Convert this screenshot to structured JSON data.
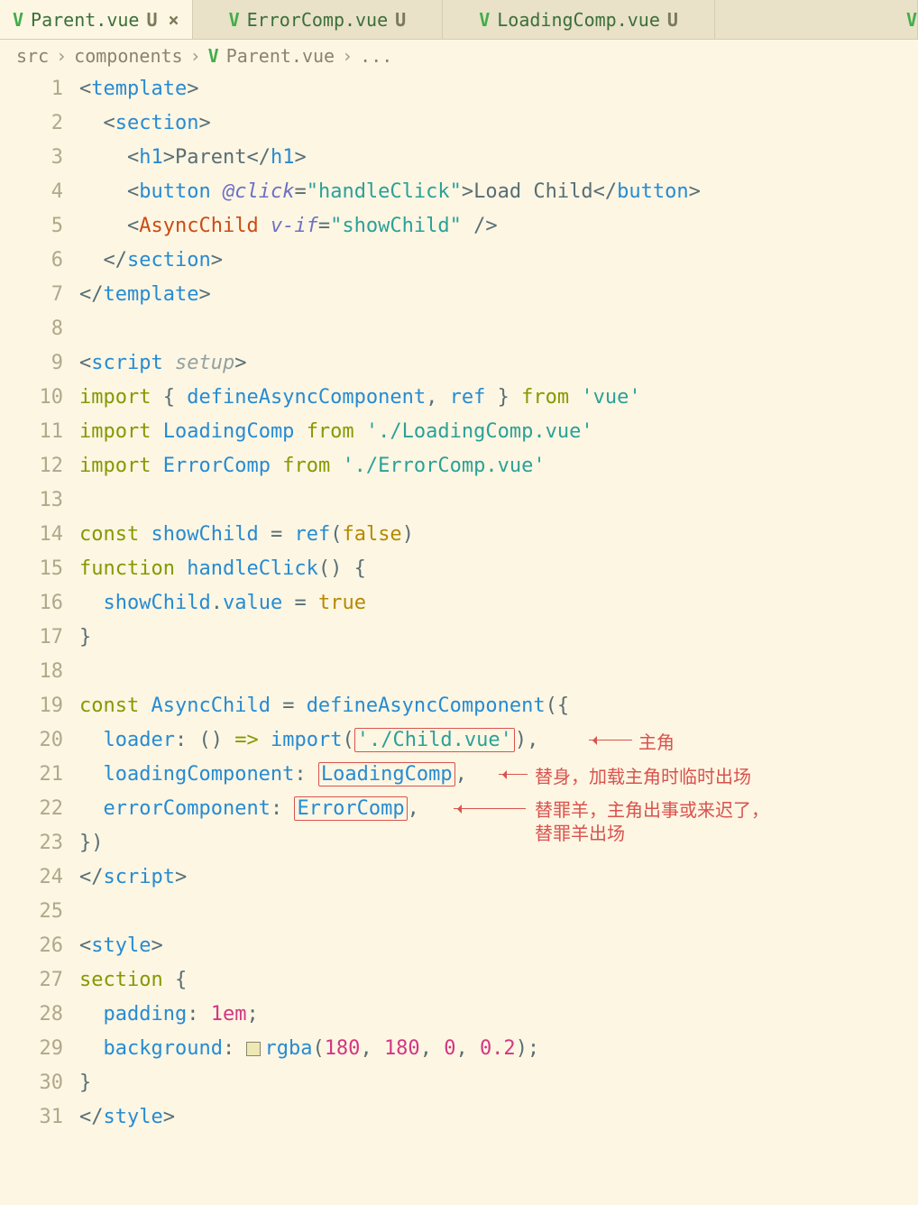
{
  "tabs": [
    {
      "icon": "V",
      "label": "Parent.vue",
      "mod": "U",
      "active": true,
      "close": true
    },
    {
      "icon": "V",
      "label": "ErrorComp.vue",
      "mod": "U",
      "active": false,
      "close": false
    },
    {
      "icon": "V",
      "label": "LoadingComp.vue",
      "mod": "U",
      "active": false,
      "close": false
    }
  ],
  "tab_stub_icon": "V",
  "breadcrumb": {
    "seg0": "src",
    "seg1": "components",
    "icon": "V",
    "seg2": "Parent.vue",
    "dots": "..."
  },
  "line_numbers": [
    "1",
    "2",
    "3",
    "4",
    "5",
    "6",
    "7",
    "8",
    "9",
    "10",
    "11",
    "12",
    "13",
    "14",
    "15",
    "16",
    "17",
    "18",
    "19",
    "20",
    "21",
    "22",
    "23",
    "24",
    "25",
    "26",
    "27",
    "28",
    "29",
    "30",
    "31"
  ],
  "code": {
    "l1": {
      "tag": "template"
    },
    "l2": {
      "tag": "section"
    },
    "l3": {
      "tag": "h1",
      "text": "Parent"
    },
    "l4": {
      "tag": "button",
      "attr": "@click",
      "val": "handleClick",
      "text": "Load Child"
    },
    "l5": {
      "tag": "AsyncChild",
      "attr": "v-if",
      "val": "showChild"
    },
    "l6": {
      "tag": "section"
    },
    "l7": {
      "tag": "template"
    },
    "l9": {
      "tag": "script",
      "attr": "setup"
    },
    "l10": {
      "kw1": "import",
      "id1": "defineAsyncComponent",
      "id2": "ref",
      "kw2": "from",
      "str": "'vue'"
    },
    "l11": {
      "kw1": "import",
      "id": "LoadingComp",
      "kw2": "from",
      "str": "'./LoadingComp.vue'"
    },
    "l12": {
      "kw1": "import",
      "id": "ErrorComp",
      "kw2": "from",
      "str": "'./ErrorComp.vue'"
    },
    "l14": {
      "kw": "const",
      "id": "showChild",
      "fn": "ref",
      "arg": "false"
    },
    "l15": {
      "kw": "function",
      "fn": "handleClick"
    },
    "l16": {
      "id": "showChild",
      "prop": "value",
      "val": "true"
    },
    "l17": {
      "brace": "}"
    },
    "l19": {
      "kw": "const",
      "id": "AsyncChild",
      "fn": "defineAsyncComponent"
    },
    "l20": {
      "key": "loader",
      "fn": "import",
      "arg": "'./Child.vue'"
    },
    "l21": {
      "key": "loadingComponent",
      "val": "LoadingComp"
    },
    "l22": {
      "key": "errorComponent",
      "val": "ErrorComp"
    },
    "l23": {
      "close": "})"
    },
    "l24": {
      "tag": "script"
    },
    "l26": {
      "tag": "style"
    },
    "l27": {
      "sel": "section"
    },
    "l28": {
      "prop": "padding",
      "val": "1em"
    },
    "l29": {
      "prop": "background",
      "fn": "rgba",
      "a": "180",
      "b": "180",
      "c": "0",
      "d": "0.2"
    },
    "l30": {
      "brace": "}"
    },
    "l31": {
      "tag": "style"
    }
  },
  "annotations": {
    "a1": "主角",
    "a2": "替身，加载主角时临时出场",
    "a3a": "替罪羊，主角出事或来迟了，",
    "a3b": "替罪羊出场"
  }
}
